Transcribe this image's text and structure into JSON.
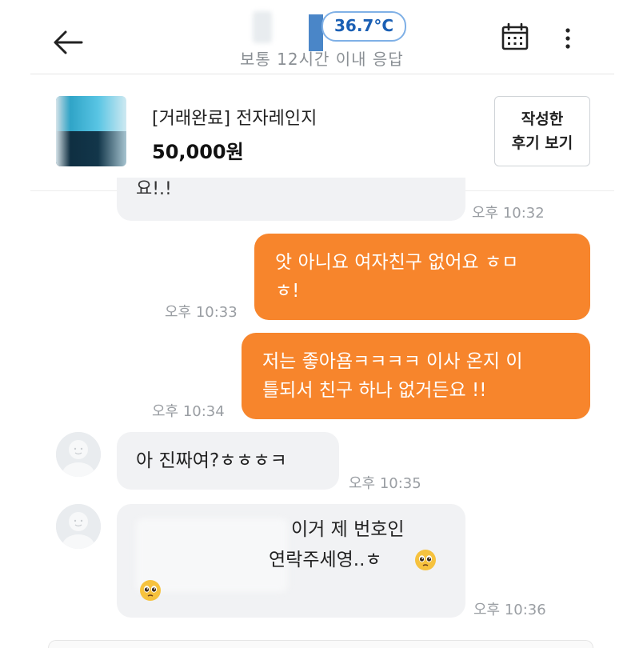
{
  "header": {
    "temperature": "36.7°C",
    "response_time": "보통 12시간 이내 응답"
  },
  "product": {
    "title": "[거래완료] 전자레인지",
    "price": "50,000원",
    "review_button_line1": "작성한",
    "review_button_line2": "후기 보기"
  },
  "messages": [
    {
      "id": 0,
      "direction": "in",
      "text": "요!.!",
      "time": "오후 10:32"
    },
    {
      "id": 1,
      "direction": "out",
      "line1": "앗 아니요 여자친구 없어요 ㅎㅁ",
      "line2": "ㅎ!",
      "time": "오후 10:33"
    },
    {
      "id": 2,
      "direction": "out",
      "line1": "저는 좋아욤ㅋㅋㅋㅋ 이사 온지 이",
      "line2": "틀되서 친구 하나 없거든요 !!",
      "time": "오후 10:34"
    },
    {
      "id": 3,
      "direction": "in",
      "text": "아 진짜여?ㅎㅎㅎㅋ",
      "time": "오후 10:35"
    },
    {
      "id": 4,
      "direction": "in",
      "line1": "이거 제 번호인",
      "line2": "연락주세영..ㅎ",
      "time": "오후 10:36"
    }
  ],
  "colors": {
    "outgoing_bubble": "#f7852c",
    "incoming_bubble": "#f1f2f4",
    "temperature_accent": "#1a5fb4"
  },
  "icons": {
    "back": "arrow-left-icon",
    "calendar": "calendar-icon",
    "more": "more-vertical-icon",
    "emoji": "pleading-face-emoji-icon"
  }
}
